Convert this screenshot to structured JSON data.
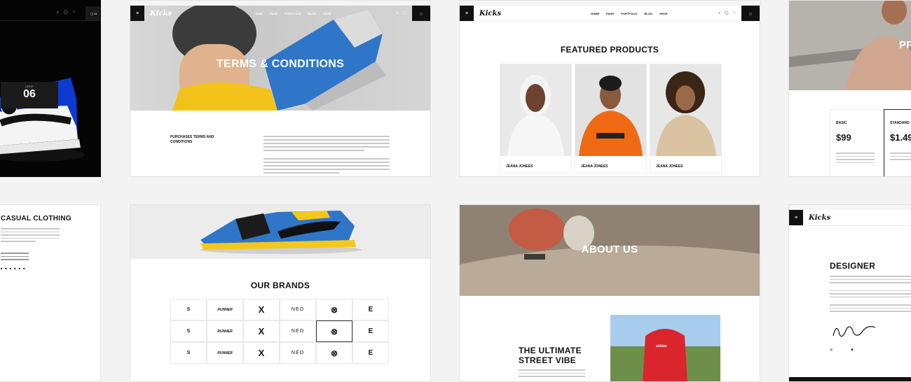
{
  "shoe_card": {
    "number": "06"
  },
  "terms_card": {
    "top_strip": "",
    "nav": {
      "logo": "Kicks",
      "links": [
        "HOME",
        "PAGE",
        "PORTFOLIO",
        "BLOG",
        "SHOP"
      ],
      "cart_count": ""
    },
    "hero_title": "TERMS & CONDITIONS",
    "section_label": "PURCHASES TERMS AND CONDITIONS"
  },
  "featured_card": {
    "nav": {
      "logo": "Kicks",
      "links": [
        "HOME",
        "PAGE",
        "PORTFOLIO",
        "BLOG",
        "SHOP"
      ]
    },
    "breadcrumb": "",
    "title": "FEATURED PRODUCTS",
    "products": [
      {
        "name": "JEANA JONEES"
      },
      {
        "name": "JEANA JONEES"
      },
      {
        "name": "JEANA JONEES"
      }
    ]
  },
  "pricing_card": {
    "hero_title": "PR",
    "plans": [
      {
        "name": "BASIC",
        "price": "$99"
      },
      {
        "name": "STANDARD",
        "price": "$1.49"
      }
    ]
  },
  "casual_card": {
    "title": "CASUAL CLOTHING"
  },
  "brands_card": {
    "title": "OUR BRANDS",
    "brands": [
      "S",
      "RUNNER",
      "X",
      "NEO",
      "⊗",
      "E"
    ]
  },
  "about_card": {
    "hero_title": "ABOUT US",
    "headline_1": "THE ULTIMATE",
    "headline_2": "STREET VIBE",
    "bag_brand": "adidas"
  },
  "designer_card": {
    "logo": "Kicks",
    "title": "DESIGNER"
  },
  "colors": {
    "accent": "#111111",
    "orange": "#ef6a13",
    "blue": "#1f5fb8",
    "red": "#d9252b"
  }
}
